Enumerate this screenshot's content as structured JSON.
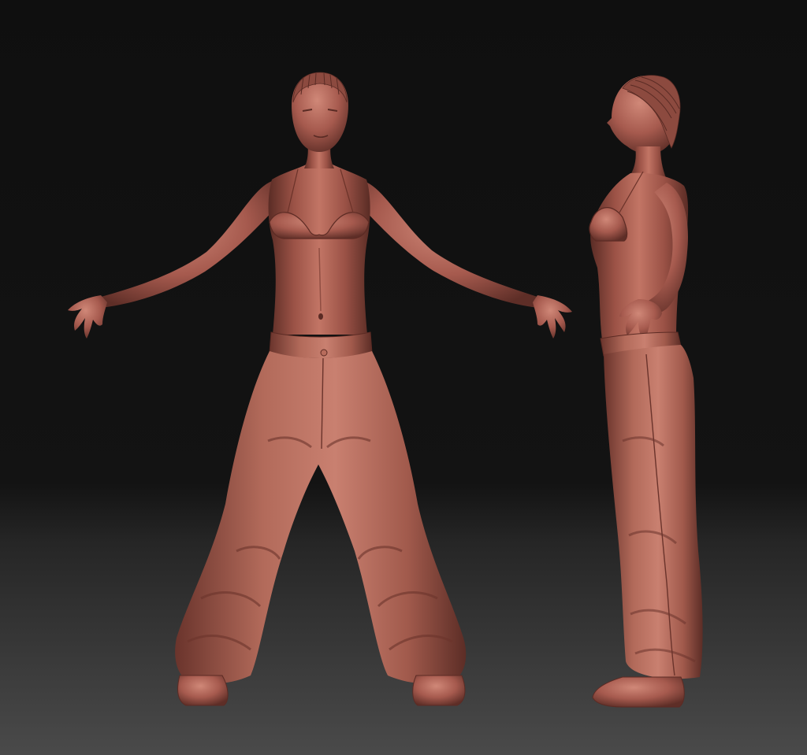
{
  "scene": {
    "background_top_color": "#0f0f0f",
    "background_mid_color": "#131313",
    "background_bottom_color": "#4a4a4a",
    "clay_color": "#a65a4e",
    "clay_highlight_color": "#d9917f",
    "clay_shadow_color": "#4f2620",
    "figures": [
      {
        "id": "front",
        "view": "front",
        "pose": "arms-out"
      },
      {
        "id": "side",
        "view": "side",
        "pose": "hand-on-hip"
      }
    ]
  }
}
